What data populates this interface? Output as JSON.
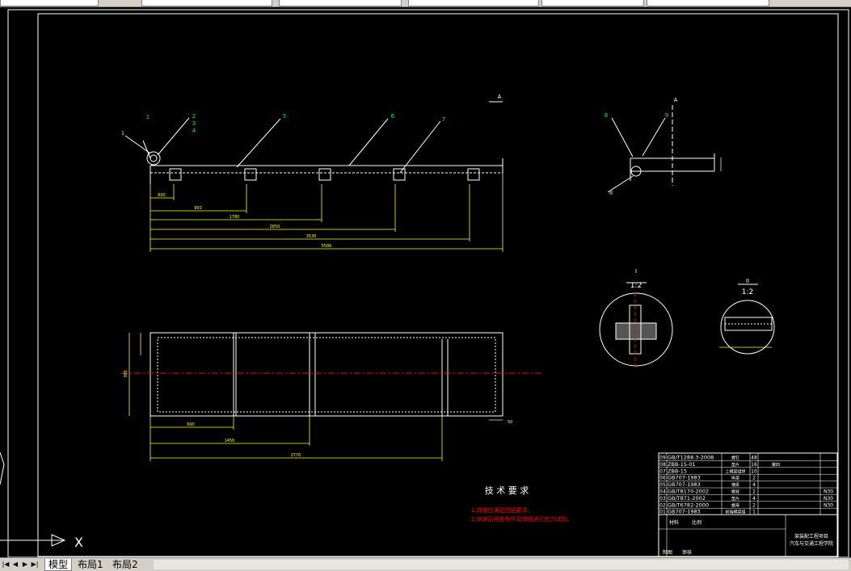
{
  "tabs": [
    "模型",
    "布局1",
    "布局2"
  ],
  "nav_buttons": [
    "|◀",
    "◀",
    "▶",
    "▶|"
  ],
  "ucs_label": "X",
  "front_view": {
    "balloons": [
      "1",
      "2",
      "3",
      "4",
      "5",
      "6",
      "7"
    ],
    "dims": [
      "690",
      "950",
      "1780",
      "2850",
      "3530",
      "5586"
    ],
    "view_label": "A"
  },
  "side_view": {
    "balloons": [
      "8",
      "9"
    ],
    "view_label": "A",
    "section_mark": "II"
  },
  "detail_views": [
    {
      "label": "I",
      "scale": "1:2"
    },
    {
      "label": "II",
      "scale": "1:2"
    }
  ],
  "plan_view": {
    "dims": [
      "690",
      "1456",
      "2770",
      "385",
      "50"
    ]
  },
  "tech_requirements": {
    "title": "技 术 要 求",
    "items": [
      "1.焊缝应满足图纸要求。",
      "2.安装后将各构件及焊缝进行应力试验。"
    ]
  },
  "bom": {
    "rows": [
      {
        "no": "09",
        "code": "GB/T1288.3-2008",
        "name": "螺钉",
        "qty": "48",
        "remark": "",
        "material": ""
      },
      {
        "no": "08",
        "code": "ZBB-15-01",
        "name": "垫片",
        "qty": "16",
        "remark": "聚四",
        "material": ""
      },
      {
        "no": "07",
        "code": "ZBB-15",
        "name": "上横梁组焊",
        "qty": "10",
        "remark": "",
        "material": ""
      },
      {
        "no": "06",
        "code": "GB707-1983",
        "name": "纵梁",
        "qty": "2",
        "remark": "",
        "material": ""
      },
      {
        "no": "05",
        "code": "GB707-1983",
        "name": "横梁",
        "qty": "4",
        "remark": "",
        "material": ""
      },
      {
        "no": "04",
        "code": "GB/T8170-2002",
        "name": "螺栓",
        "qty": "2",
        "remark": "",
        "material": "N30"
      },
      {
        "no": "03",
        "code": "GB/T871-2002",
        "name": "垫片",
        "qty": "4",
        "remark": "",
        "material": "N30"
      },
      {
        "no": "02",
        "code": "GB/T6782-2000",
        "name": "螺母",
        "qty": "2",
        "remark": "",
        "material": "N30"
      },
      {
        "no": "01",
        "code": "GB707-1983",
        "name": "前端横梁组",
        "qty": "1",
        "remark": "",
        "material": ""
      }
    ],
    "title_lines": [
      "某装配工程项目",
      "汽车与交通工程学院"
    ],
    "labels": [
      "材料",
      "比例",
      "制图",
      "审核"
    ]
  },
  "colors": {
    "background": "#000000",
    "drawing": "#ffffff",
    "dimension": "#ffff00",
    "centerline": "#ff0000",
    "balloon": "#00ff00",
    "requirement_text": "#ff0000",
    "ui_face": "#d4d0c8"
  }
}
